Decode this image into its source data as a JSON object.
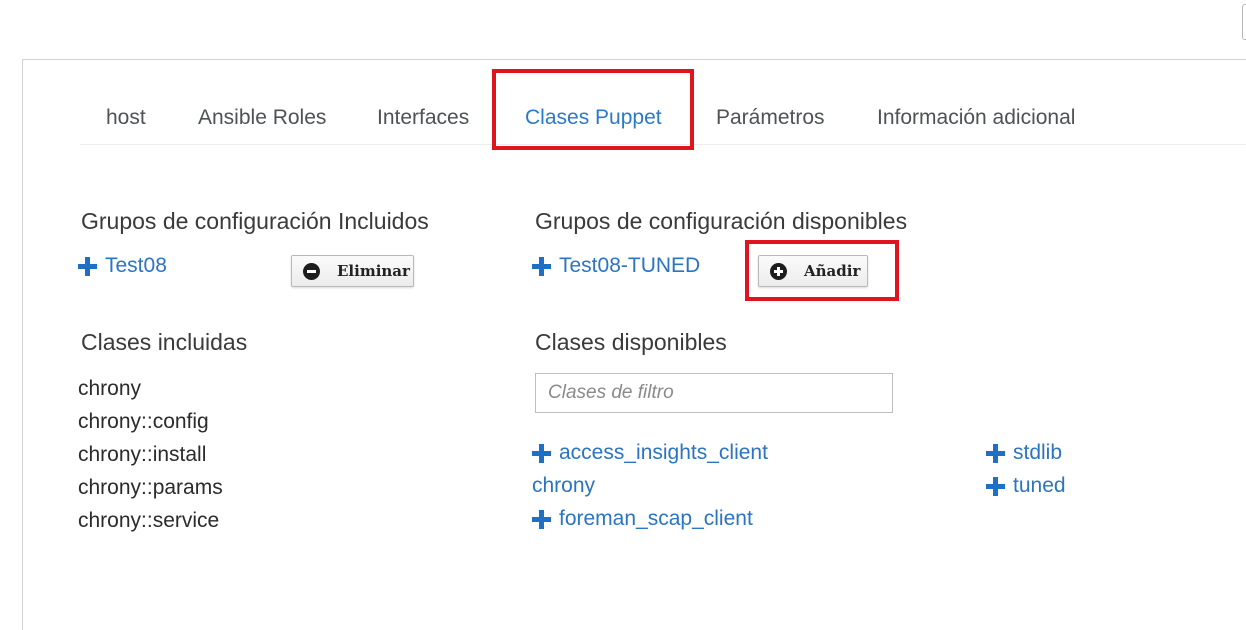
{
  "tabs": [
    {
      "label": "host",
      "active": false
    },
    {
      "label": "Ansible Roles",
      "active": false
    },
    {
      "label": "Interfaces",
      "active": false
    },
    {
      "label": "Clases Puppet",
      "active": true
    },
    {
      "label": "Parámetros",
      "active": false
    },
    {
      "label": "Información adicional",
      "active": false
    }
  ],
  "config_groups": {
    "included": {
      "heading": "Grupos de configuración Incluidos",
      "item": "Test08",
      "remove_button": "Eliminar"
    },
    "available": {
      "heading": "Grupos de configuración disponibles",
      "item": "Test08-TUNED",
      "add_button": "Añadir"
    }
  },
  "classes": {
    "included": {
      "heading": "Clases incluidas",
      "items": [
        "chrony",
        "chrony::config",
        "chrony::install",
        "chrony::params",
        "chrony::service"
      ]
    },
    "available": {
      "heading": "Clases disponibles",
      "filter_placeholder": "Clases de filtro",
      "filter_value": "",
      "column1": [
        {
          "label": "access_insights_client",
          "expandable": true
        },
        {
          "label": "chrony",
          "expandable": false
        },
        {
          "label": "foreman_scap_client",
          "expandable": true
        }
      ],
      "column2": [
        {
          "label": "stdlib",
          "expandable": true
        },
        {
          "label": "tuned",
          "expandable": true
        }
      ]
    }
  },
  "colors": {
    "link": "#2b74c2",
    "active_tab": "#2b7ac9",
    "highlight_box": "#e0141e"
  }
}
